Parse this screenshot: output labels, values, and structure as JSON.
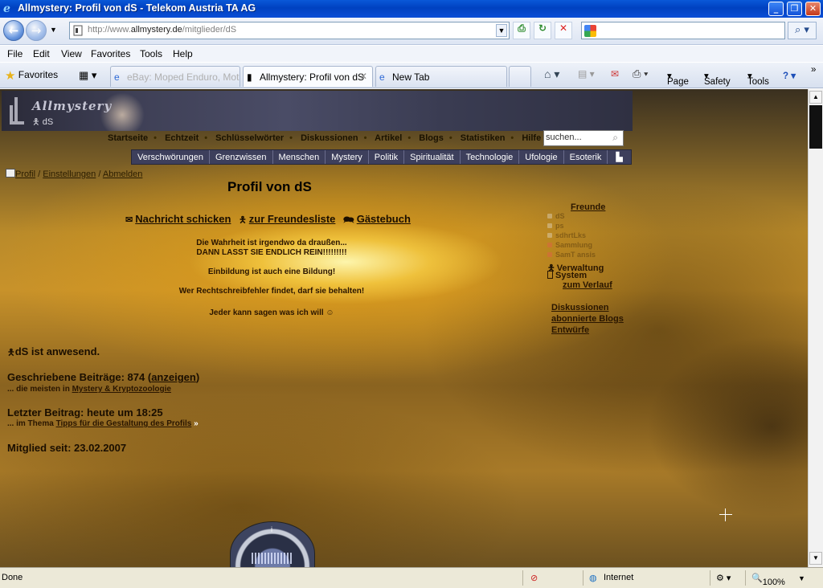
{
  "window": {
    "title": "Allmystery: Profil von dS - Telekom Austria TA AG"
  },
  "address": {
    "url_prefix": "http://www.",
    "url_domain": "allmystery.de",
    "url_path": "/mitglieder/dS"
  },
  "menu": [
    "File",
    "Edit",
    "View",
    "Favorites",
    "Tools",
    "Help"
  ],
  "toolbar": {
    "favorites_label": "Favorites",
    "tabs": [
      {
        "label": "eBay: Moped Enduro, Mot..."
      },
      {
        "label": "Allmystery: Profil von dS"
      },
      {
        "label": "New Tab"
      }
    ],
    "page_label": "Page",
    "safety_label": "Safety",
    "tools_label": "Tools"
  },
  "site": {
    "brand": "Allmystery",
    "username": "dS",
    "nav": [
      "Startseite",
      "Echtzeit",
      "Schlüsselwörter",
      "Diskussionen",
      "Artikel",
      "Blogs",
      "Statistiken",
      "Hilfe"
    ],
    "search_placeholder": "suchen...",
    "categories": [
      "Verschwörungen",
      "Grenzwissen",
      "Menschen",
      "Mystery",
      "Politik",
      "Spiritualität",
      "Technologie",
      "Ufologie",
      "Esoterik"
    ]
  },
  "crumbs": {
    "profil": "Profil",
    "einstellungen": "Einstellungen",
    "abmelden": "Abmelden"
  },
  "profile": {
    "title": "Profil von dS",
    "actions": {
      "message": "Nachricht schicken",
      "friendslist": "zur Freundesliste",
      "guestbook": "Gästebuch"
    },
    "quotes": [
      "Die Wahrheit ist irgendwo da draußen...",
      "DANN LASST SIE ENDLICH REIN!!!!!!!!!",
      "Einbildung ist auch eine Bildung!",
      "Wer Rechtschreibfehler findet, darf sie behalten!",
      "Jeder kann sagen was ich will"
    ],
    "presence": "dS ist anwesend.",
    "posts_label": "Geschriebene Beiträge: 874 (",
    "posts_link": "anzeigen",
    "posts_close": ")",
    "most_prefix": "... die meisten in ",
    "most_link": "Mystery & Kryptozoologie",
    "last_post": "Letzter Beitrag: heute um 18:25",
    "last_thread_prefix": "... im Thema ",
    "last_thread_link": "Tipps für die Gestaltung des Profils",
    "member_since": "Mitglied seit: 23.02.2007"
  },
  "friends": {
    "header": "Freunde",
    "blurred": [
      "dS",
      "ps",
      "sdhrtLks",
      "Sammlung",
      "SamT ansis"
    ],
    "verwaltung": "Verwaltung",
    "system": "System",
    "verlauf": "zum Verlauf",
    "links": [
      "Diskussionen",
      "abonnierte Blogs",
      "Entwürfe"
    ]
  },
  "statusbar": {
    "left": "Done",
    "zone": "Internet",
    "zoom": "100%"
  }
}
